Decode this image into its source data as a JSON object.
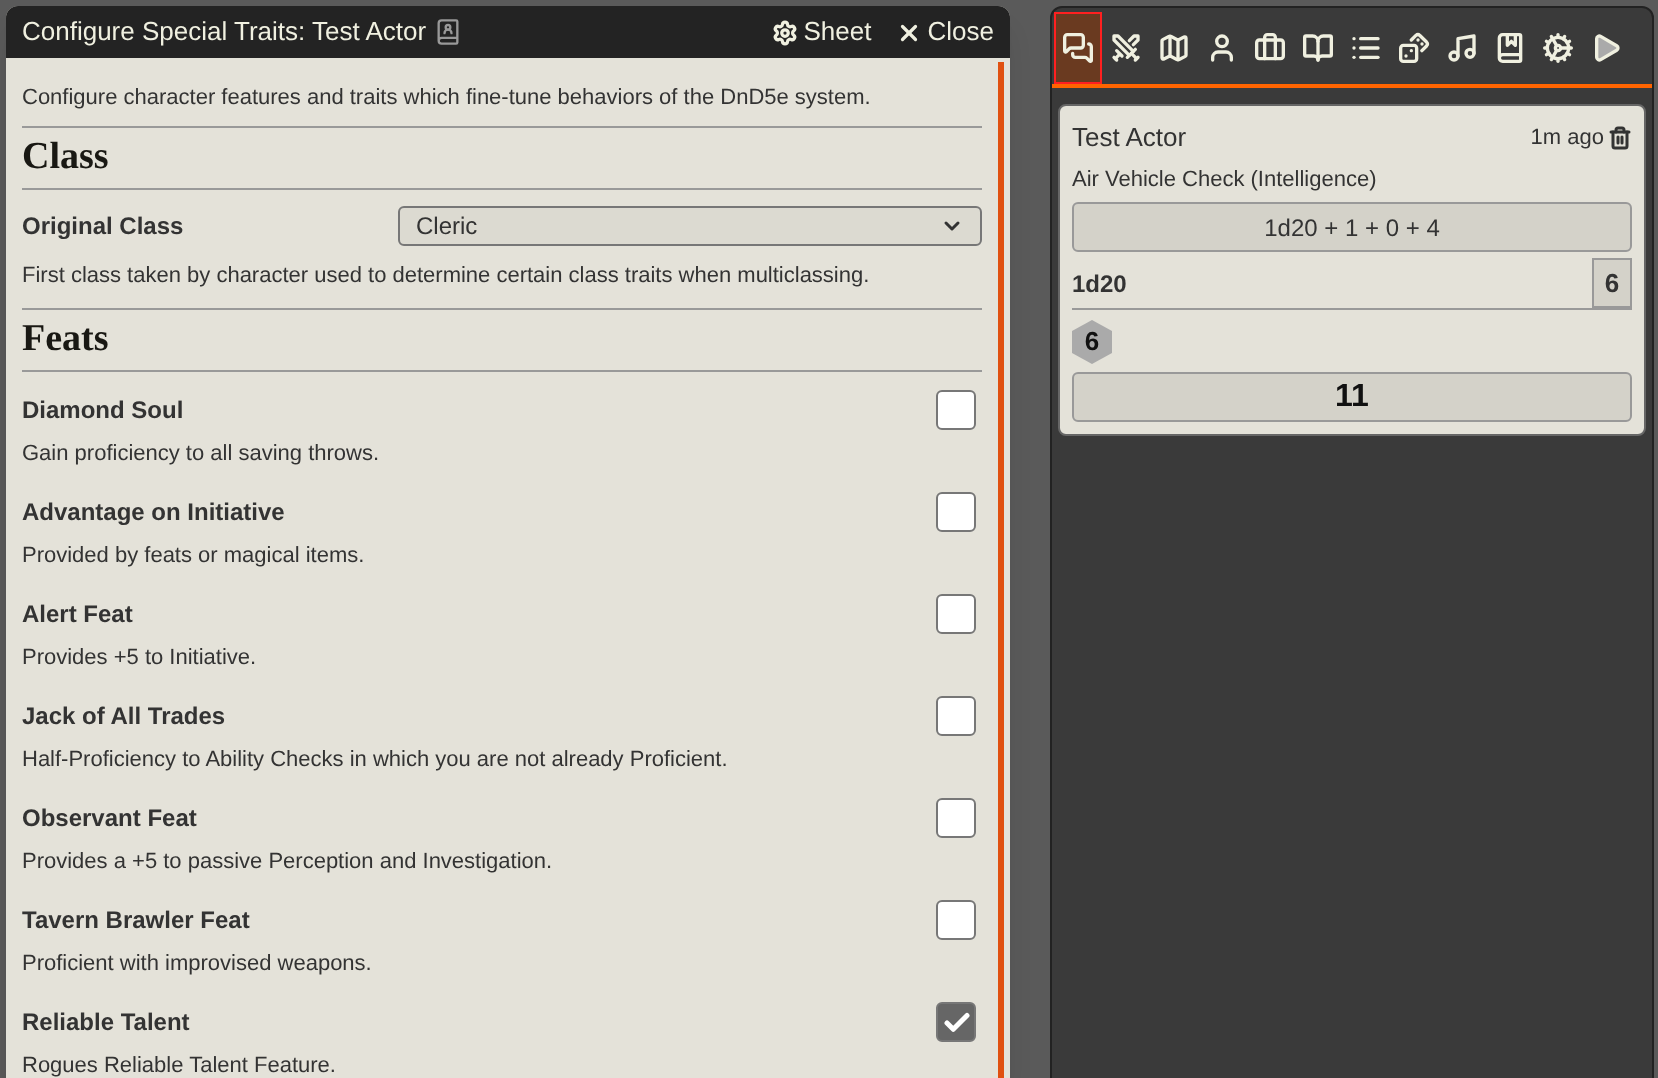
{
  "window": {
    "title": "Configure Special Traits: Test Actor",
    "header_buttons": [
      {
        "kind": "sheet",
        "label": "Sheet"
      },
      {
        "kind": "close",
        "label": "Close"
      }
    ]
  },
  "intro": "Configure character features and traits which fine-tune behaviors of the DnD5e system.",
  "class_section": {
    "heading": "Class",
    "label": "Original Class",
    "value": "Cleric",
    "hint": "First class taken by character used to determine certain class traits when multiclassing."
  },
  "feats_section": {
    "heading": "Feats",
    "feats": [
      {
        "name": "Diamond Soul",
        "hint": "Gain proficiency to all saving throws.",
        "checked": false
      },
      {
        "name": "Advantage on Initiative",
        "hint": "Provided by feats or magical items.",
        "checked": false
      },
      {
        "name": "Alert Feat",
        "hint": "Provides +5 to Initiative.",
        "checked": false
      },
      {
        "name": "Jack of All Trades",
        "hint": "Half-Proficiency to Ability Checks in which you are not already Proficient.",
        "checked": false
      },
      {
        "name": "Observant Feat",
        "hint": "Provides a +5 to passive Perception and Investigation.",
        "checked": false
      },
      {
        "name": "Tavern Brawler Feat",
        "hint": "Proficient with improvised weapons.",
        "checked": false
      },
      {
        "name": "Reliable Talent",
        "hint": "Rogues Reliable Talent Feature.",
        "checked": true
      }
    ]
  },
  "sidebar": {
    "tabs": [
      {
        "kind": "chat",
        "selected": true
      },
      {
        "kind": "combat",
        "selected": false
      },
      {
        "kind": "scenes",
        "selected": false
      },
      {
        "kind": "actors",
        "selected": false
      },
      {
        "kind": "items",
        "selected": false
      },
      {
        "kind": "journal",
        "selected": false
      },
      {
        "kind": "tables",
        "selected": false
      },
      {
        "kind": "cards",
        "selected": false
      },
      {
        "kind": "playlists",
        "selected": false
      },
      {
        "kind": "compendium",
        "selected": false
      },
      {
        "kind": "settings",
        "selected": false
      },
      {
        "kind": "collapse",
        "selected": false
      }
    ],
    "message": {
      "speaker": "Test Actor",
      "time": "1m ago",
      "flavor": "Air Vehicle Check (Intelligence)",
      "formula": "1d20 + 1 + 0 + 4",
      "dice_formula": "1d20",
      "dice_total": "6",
      "die_result": "6",
      "total": "11"
    }
  }
}
